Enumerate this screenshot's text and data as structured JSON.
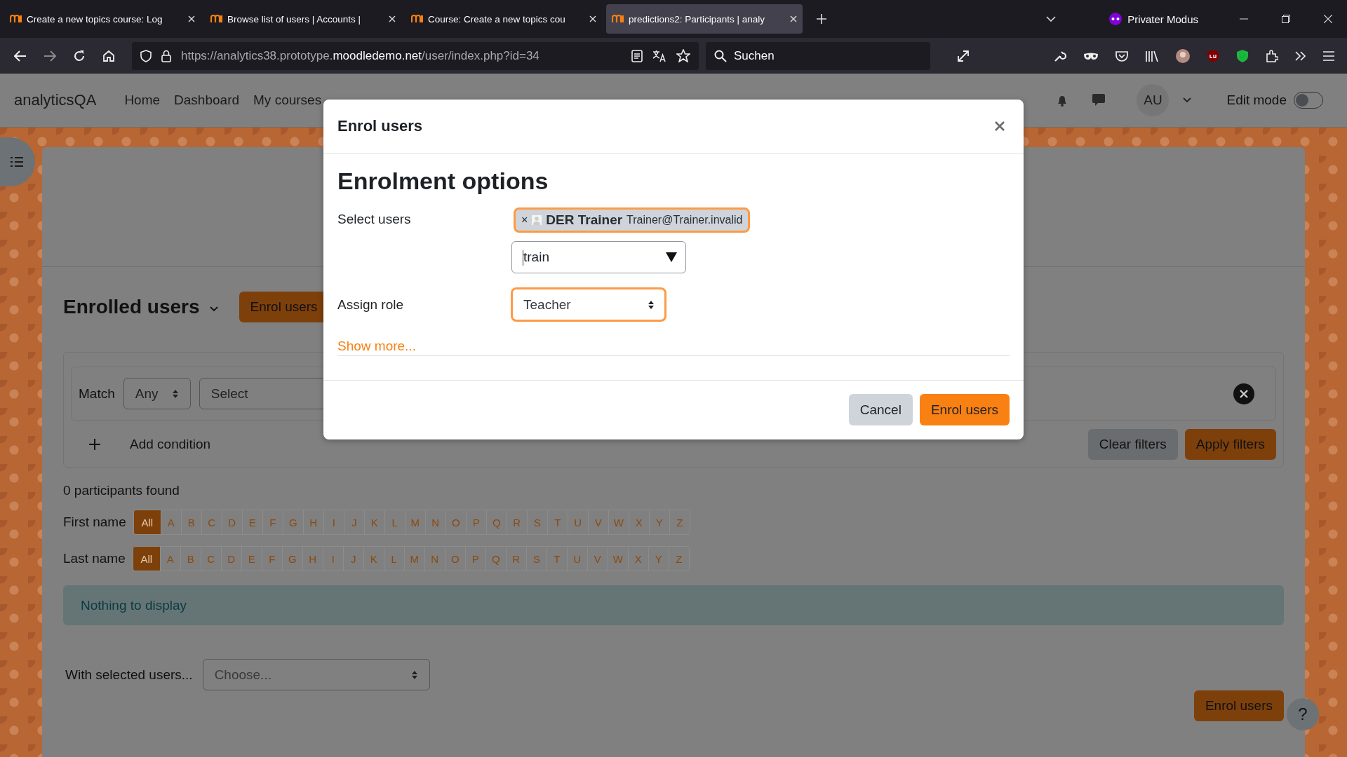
{
  "browser": {
    "tabs": [
      {
        "title": "Create a new topics course: Log",
        "selected": false
      },
      {
        "title": "Browse list of users | Accounts |",
        "selected": false
      },
      {
        "title": "Course: Create a new topics cou",
        "selected": false
      },
      {
        "title": "predictions2: Participants | analy",
        "selected": true
      }
    ],
    "private_mode": "Privater Modus",
    "url": {
      "prefix": "https://analytics38.prototype.",
      "domain": "moodledemo.net",
      "path": "/user/index.php?id=34"
    },
    "search": {
      "placeholder": "Suchen"
    }
  },
  "site": {
    "brand": "analyticsQA",
    "nav": [
      "Home",
      "Dashboard",
      "My courses"
    ],
    "avatar": "AU",
    "edit_mode": {
      "label": "Edit mode",
      "on": false
    }
  },
  "page": {
    "heading": "Enrolled users",
    "enrol_button": "Enrol users",
    "filter": {
      "match_label": "Match",
      "match_value": "Any",
      "select_placeholder": "Select",
      "add_condition": "Add condition",
      "clear": "Clear filters",
      "apply": "Apply filters"
    },
    "count": "0 participants found",
    "initials": [
      {
        "label": "First name",
        "letters": [
          {
            "text": "All",
            "selected": true
          },
          {
            "text": "A",
            "selected": false
          },
          {
            "text": "B",
            "selected": false
          },
          {
            "text": "C",
            "selected": false
          },
          {
            "text": "D",
            "selected": false
          },
          {
            "text": "E",
            "selected": false
          },
          {
            "text": "F",
            "selected": false
          },
          {
            "text": "G",
            "selected": false
          },
          {
            "text": "H",
            "selected": false
          },
          {
            "text": "I",
            "selected": false
          },
          {
            "text": "J",
            "selected": false
          },
          {
            "text": "K",
            "selected": false
          },
          {
            "text": "L",
            "selected": false
          },
          {
            "text": "M",
            "selected": false
          },
          {
            "text": "N",
            "selected": false
          },
          {
            "text": "O",
            "selected": false
          },
          {
            "text": "P",
            "selected": false
          },
          {
            "text": "Q",
            "selected": false
          },
          {
            "text": "R",
            "selected": false
          },
          {
            "text": "S",
            "selected": false
          },
          {
            "text": "T",
            "selected": false
          },
          {
            "text": "U",
            "selected": false
          },
          {
            "text": "V",
            "selected": false
          },
          {
            "text": "W",
            "selected": false
          },
          {
            "text": "X",
            "selected": false
          },
          {
            "text": "Y",
            "selected": false
          },
          {
            "text": "Z",
            "selected": false
          }
        ]
      },
      {
        "label": "Last name",
        "letters": [
          {
            "text": "All",
            "selected": true
          },
          {
            "text": "A",
            "selected": false
          },
          {
            "text": "B",
            "selected": false
          },
          {
            "text": "C",
            "selected": false
          },
          {
            "text": "D",
            "selected": false
          },
          {
            "text": "E",
            "selected": false
          },
          {
            "text": "F",
            "selected": false
          },
          {
            "text": "G",
            "selected": false
          },
          {
            "text": "H",
            "selected": false
          },
          {
            "text": "I",
            "selected": false
          },
          {
            "text": "J",
            "selected": false
          },
          {
            "text": "K",
            "selected": false
          },
          {
            "text": "L",
            "selected": false
          },
          {
            "text": "M",
            "selected": false
          },
          {
            "text": "N",
            "selected": false
          },
          {
            "text": "O",
            "selected": false
          },
          {
            "text": "P",
            "selected": false
          },
          {
            "text": "Q",
            "selected": false
          },
          {
            "text": "R",
            "selected": false
          },
          {
            "text": "S",
            "selected": false
          },
          {
            "text": "T",
            "selected": false
          },
          {
            "text": "U",
            "selected": false
          },
          {
            "text": "V",
            "selected": false
          },
          {
            "text": "W",
            "selected": false
          },
          {
            "text": "X",
            "selected": false
          },
          {
            "text": "Y",
            "selected": false
          },
          {
            "text": "Z",
            "selected": false
          }
        ]
      }
    ],
    "empty_message": "Nothing to display",
    "bulk_label": "With selected users...",
    "bulk_placeholder": "Choose...",
    "bottom_enrol_button": "Enrol users",
    "help": "?"
  },
  "modal": {
    "title": "Enrol users",
    "heading": "Enrolment options",
    "select_users_label": "Select users",
    "selected_user": {
      "remove": "×",
      "name": "DER Trainer",
      "email": "Trainer@Trainer.invalid"
    },
    "search_value": "train",
    "role_label": "Assign role",
    "role_value": "Teacher",
    "show_more": "Show more...",
    "cancel": "Cancel",
    "submit": "Enrol users"
  }
}
